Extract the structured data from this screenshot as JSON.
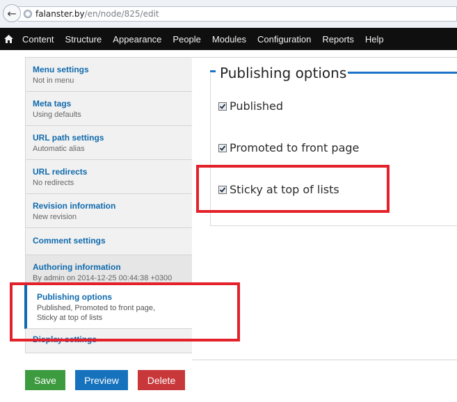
{
  "browser": {
    "url_host": "falanster.by",
    "url_path": "/en/node/825/edit"
  },
  "toolbar": {
    "items": [
      "Content",
      "Structure",
      "Appearance",
      "People",
      "Modules",
      "Configuration",
      "Reports",
      "Help"
    ]
  },
  "vertical_tabs": [
    {
      "title": "Menu settings",
      "summary": "Not in menu"
    },
    {
      "title": "Meta tags",
      "summary": "Using defaults"
    },
    {
      "title": "URL path settings",
      "summary": "Automatic alias"
    },
    {
      "title": "URL redirects",
      "summary": "No redirects"
    },
    {
      "title": "Revision information",
      "summary": "New revision"
    },
    {
      "title": "Comment settings",
      "summary": ""
    },
    {
      "title": "Authoring information",
      "summary": "By admin on 2014-12-25 00:44:38 +0300"
    },
    {
      "title": "Publishing options",
      "summary_line1": "Published, Promoted to front page,",
      "summary_line2": "Sticky at top of lists"
    },
    {
      "title": "Display settings",
      "summary": ""
    }
  ],
  "publishing": {
    "legend": "Publishing options",
    "options": [
      {
        "label": "Published",
        "checked": true
      },
      {
        "label": "Promoted to front page",
        "checked": true
      },
      {
        "label": "Sticky at top of lists",
        "checked": true
      }
    ]
  },
  "actions": {
    "save": "Save",
    "preview": "Preview",
    "delete": "Delete"
  },
  "colors": {
    "link_blue": "#0f6aad",
    "save": "#3c9a3f",
    "preview": "#1672bd",
    "delete": "#c8383b",
    "annotation_red": "#e3212b"
  }
}
